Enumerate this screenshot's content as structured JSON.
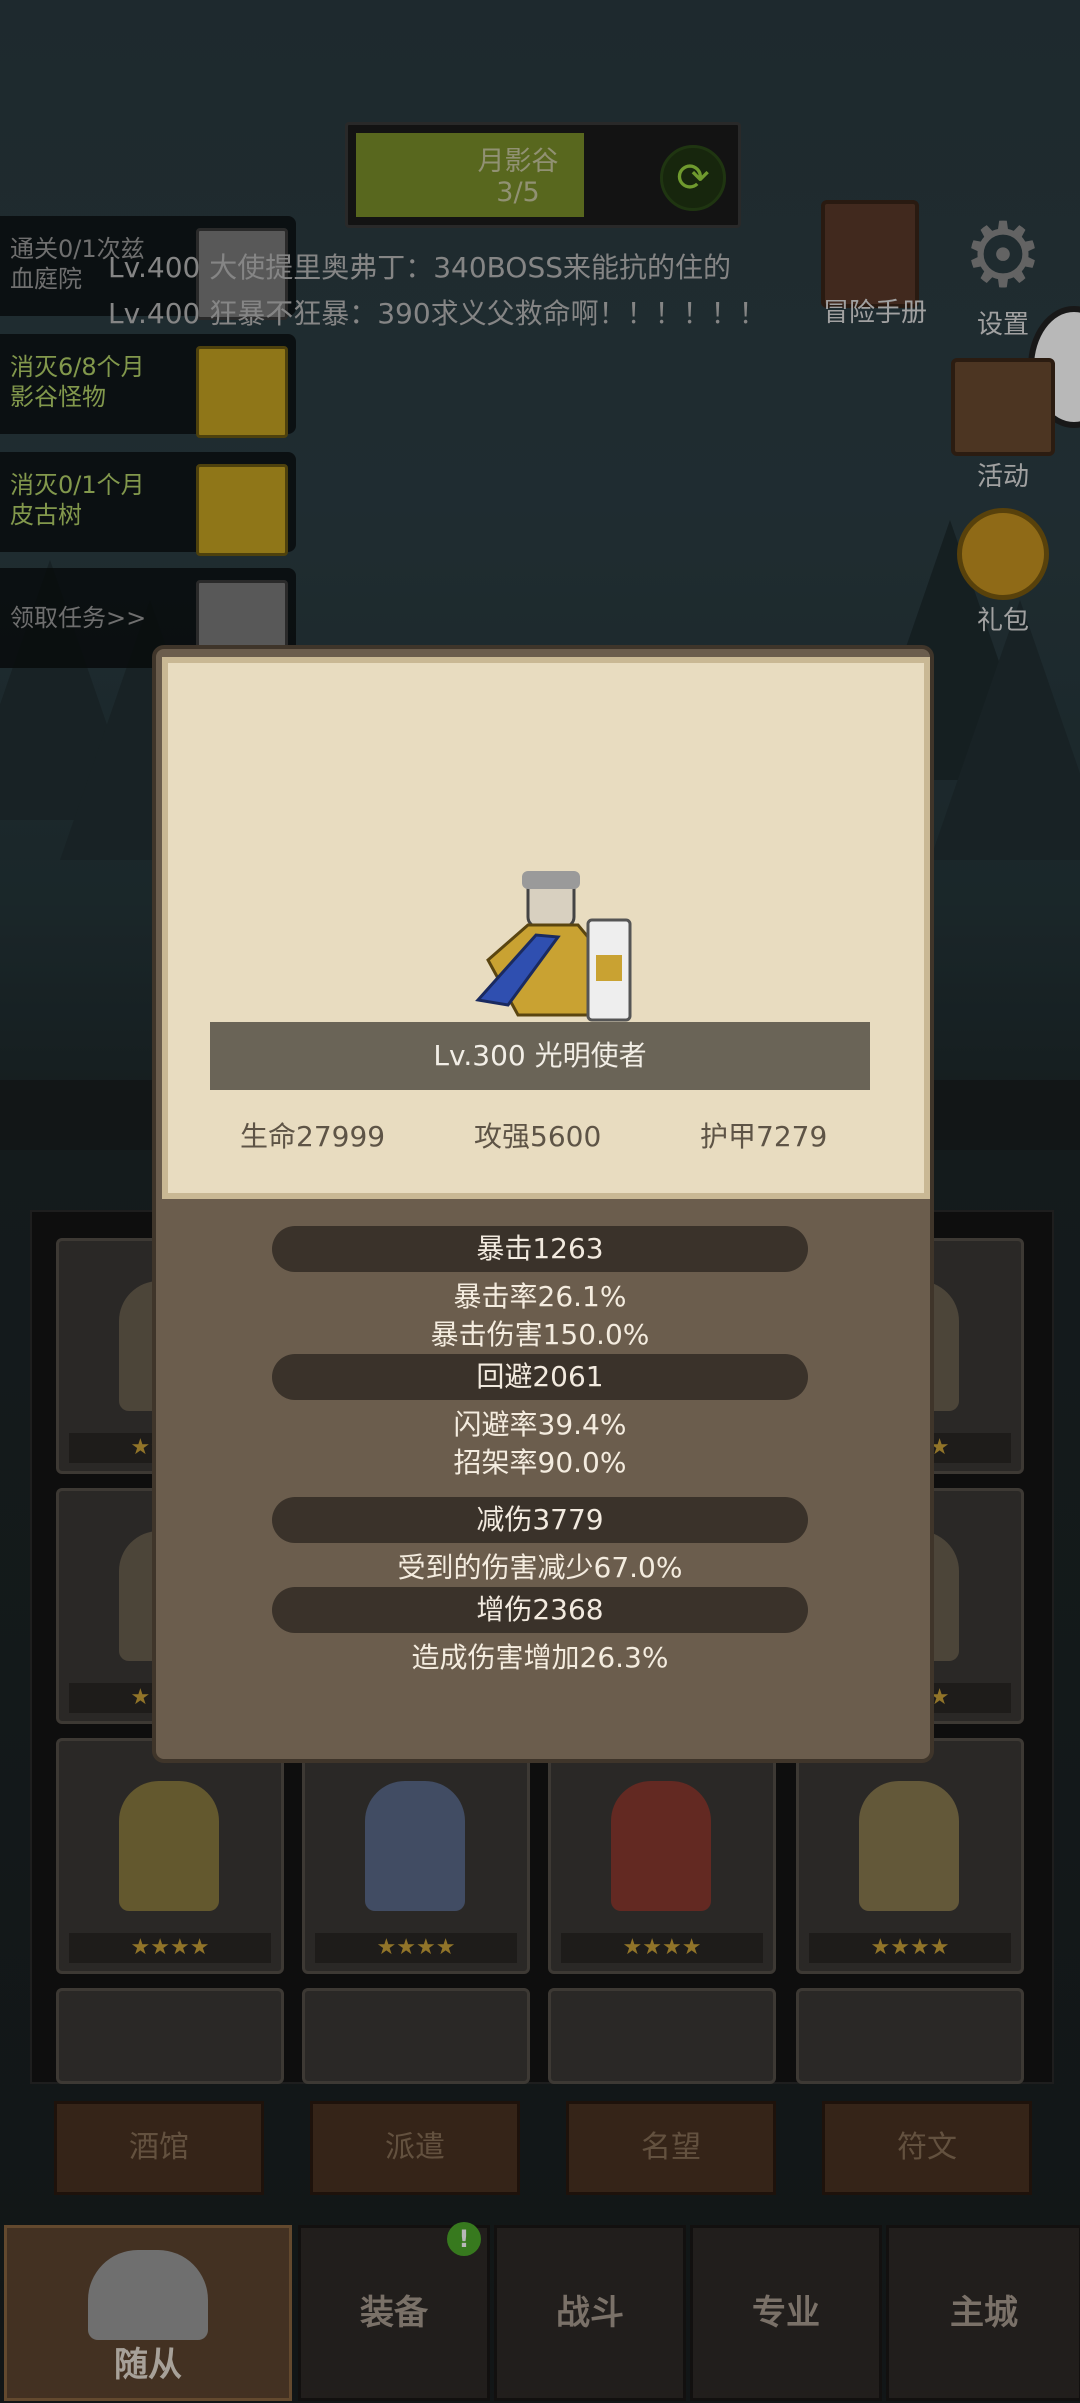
{
  "top_progress": {
    "title": "月影谷",
    "count": "3/5",
    "fill_fraction": 0.6
  },
  "quests": [
    {
      "text": "通关0/1次兹\n血庭院",
      "status": "gray"
    },
    {
      "text": "消灭6/8个月\n影谷怪物",
      "status": "gold"
    },
    {
      "text": "消灭0/1个月\n皮古树",
      "status": "gold"
    },
    {
      "text": "领取任务>>",
      "status": "gray"
    }
  ],
  "chat": [
    "Lv.400 大使提里奥弗丁：340BOSS来能抗的住的",
    "Lv.400 狂暴不狂暴：390求义父救命啊！！！！！！"
  ],
  "right_menu": {
    "handbook": "冒险手册",
    "settings": "设置",
    "events": "活动",
    "gift": "礼包"
  },
  "hero": {
    "name": "Lv.300 光明使者",
    "hp": "生命27999",
    "attack": "攻强5600",
    "armor": "护甲7279"
  },
  "stats": {
    "crit": "暴击1263",
    "crit_rate": "暴击率26.1%",
    "crit_damage": "暴击伤害150.0%",
    "evade": "回避2061",
    "dodge_rate": "闪避率39.4%",
    "parry_rate": "招架率90.0%",
    "reduce": "减伤3779",
    "reduce_desc": "受到的伤害减少67.0%",
    "increase": "增伤2368",
    "increase_desc": "造成伤害增加26.3%"
  },
  "grid_stars": "★★★★",
  "sub_tabs": [
    "酒馆",
    "派遣",
    "名望",
    "符文"
  ],
  "nav": [
    "随从",
    "装备",
    "战斗",
    "专业",
    "主城"
  ],
  "colors": {
    "accent_gold": "#c6a422",
    "panel_bg": "#e8dcc0",
    "modal_bg": "#6b5d4d",
    "quest_text": "#b4d36a"
  }
}
